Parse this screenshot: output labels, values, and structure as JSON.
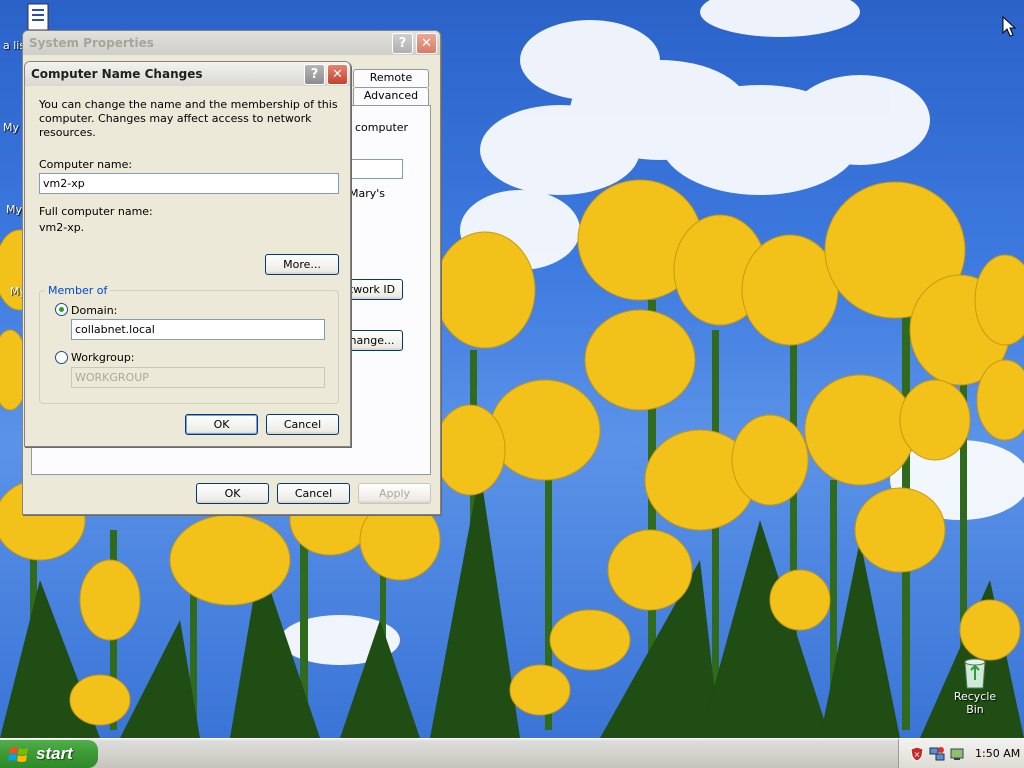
{
  "desktop": {
    "icons": [
      {
        "label": "a lis"
      },
      {
        "label": "My I"
      },
      {
        "label": "My"
      },
      {
        "label": "My"
      },
      {
        "label": "Recycle Bin"
      }
    ]
  },
  "system_properties": {
    "title": "System Properties",
    "tabs": {
      "remote": "Remote",
      "advanced": "Advanced"
    },
    "partial_text": {
      "computer": "computer",
      "marys": "Mary's"
    },
    "network_id_button": "twork ID",
    "change_button": "hange...",
    "ok": "OK",
    "cancel": "Cancel",
    "apply": "Apply"
  },
  "dialog": {
    "title": "Computer Name Changes",
    "description": "You can change the name and the membership of this computer. Changes may affect access to network resources.",
    "computer_name_label": "Computer name:",
    "computer_name_value": "vm2-xp",
    "full_name_label": "Full computer name:",
    "full_name_value": "vm2-xp.",
    "more_button": "More...",
    "member_of_label": "Member of",
    "domain_label": "Domain:",
    "domain_value": "collabnet.local",
    "domain_selected": true,
    "workgroup_label": "Workgroup:",
    "workgroup_value": "WORKGROUP",
    "ok": "OK",
    "cancel": "Cancel"
  },
  "taskbar": {
    "start_label": "start",
    "clock": "1:50 AM"
  },
  "colors": {
    "sky": "#3d7ae0",
    "tulip": "#f2c21a",
    "xp_face": "#ece9d8",
    "start_green": "#3d9a34"
  }
}
